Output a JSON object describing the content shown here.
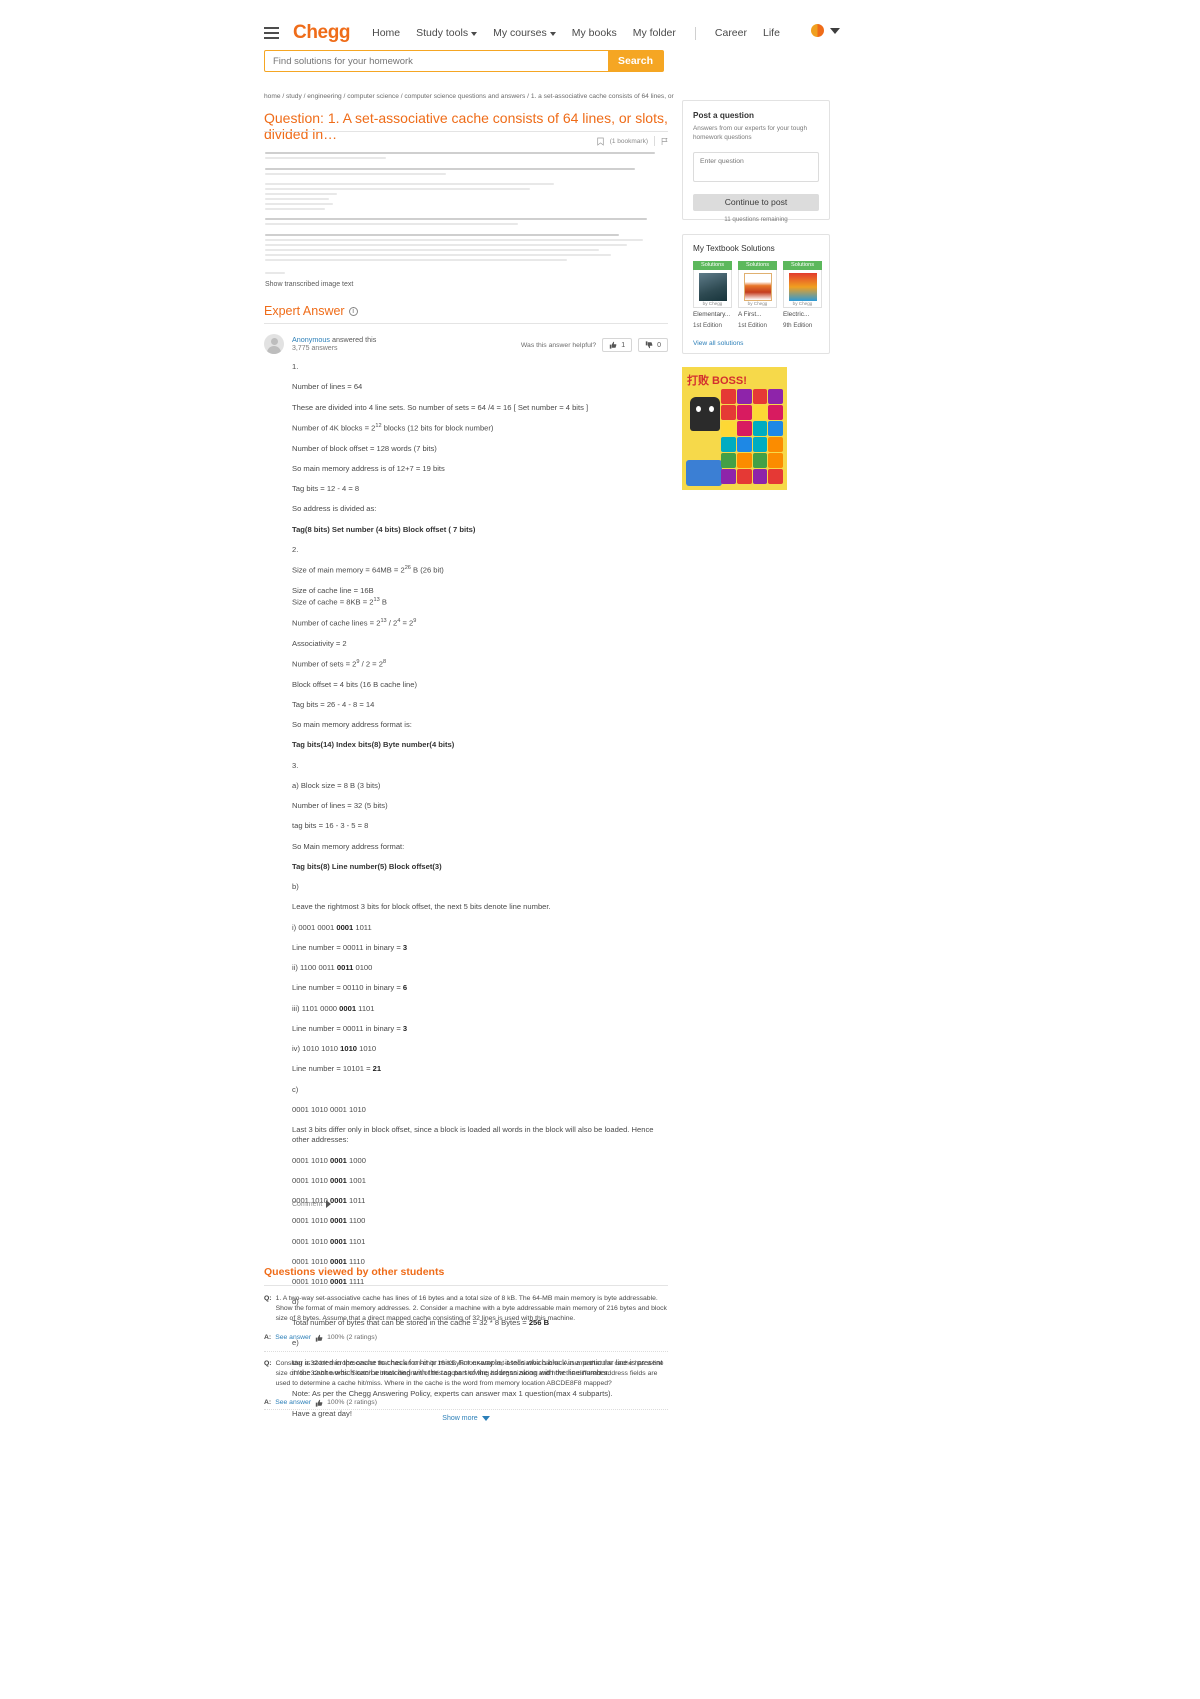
{
  "header": {
    "brand": "Chegg",
    "menu_icon": "hamburger-icon",
    "nav": [
      {
        "label": "Home",
        "caret": false
      },
      {
        "label": "Study tools",
        "caret": true
      },
      {
        "label": "My courses",
        "caret": true
      },
      {
        "label": "My books",
        "caret": false
      },
      {
        "label": "My folder",
        "caret": false
      },
      {
        "label": "Career",
        "caret": false
      },
      {
        "label": "Life",
        "caret": false
      }
    ]
  },
  "search": {
    "placeholder": "Find solutions for your homework",
    "value": "",
    "button_label": "Search"
  },
  "breadcrumb": "home / study / engineering / computer science / computer science questions and answers / 1. a set-associative cache consists of 64 lines, or slots, divi...",
  "question": {
    "title": "Question: 1. A set-associative cache consists of 64 lines, or slots, divided in…",
    "bookmarks": "(1 bookmark)",
    "show_transcribed": "Show transcribed image text"
  },
  "expert_answer": {
    "heading": "Expert Answer",
    "info_glyph": "i",
    "author": "Anonymous",
    "author_suffix": " answered this",
    "answers_count": "3,775 answers",
    "helpful_label": "Was this answer helpful?",
    "upvotes": "1",
    "downvotes": "0",
    "comment_label": "Comment",
    "body": [
      {
        "t": "1.",
        "style": "normal"
      },
      {
        "t": "Number of lines = 64",
        "style": "normal"
      },
      {
        "t": "These are divided into 4 line sets. So number of sets = 64 /4 = 16 [ Set number = 4 bits ]",
        "style": "normal"
      },
      {
        "t": "Number of 4K blocks = 2^12 blocks (12 bits for block number)",
        "style": "normal"
      },
      {
        "t": "Number of block offset = 128 words (7 bits)",
        "style": "normal"
      },
      {
        "t": "So main memory address is of 12+7 = 19 bits",
        "style": "normal"
      },
      {
        "t": "Tag bits = 12 - 4 = 8",
        "style": "normal"
      },
      {
        "t": "So address is divided as:",
        "style": "normal"
      },
      {
        "t": "Tag(8 bits) Set number (4 bits) Block offset ( 7 bits)",
        "style": "bold"
      },
      {
        "t": "2.",
        "style": "normal"
      },
      {
        "t": "Size of main memory = 64MB = 2^26 B (26 bit)",
        "style": "normal"
      },
      {
        "t": "Size of cache line = 16B",
        "style": "tight"
      },
      {
        "t": "Size of cache = 8KB = 2^13 B",
        "style": "normal"
      },
      {
        "t": "Number of cache lines = 2^13 / 2^4 = 2^9",
        "style": "normal"
      },
      {
        "t": "Associativity = 2",
        "style": "normal"
      },
      {
        "t": "Number of sets = 2^9 / 2 = 2^8",
        "style": "normal"
      },
      {
        "t": "Block offset = 4 bits (16 B cache line)",
        "style": "normal"
      },
      {
        "t": "Tag bits = 26 - 4 - 8 = 14",
        "style": "normal"
      },
      {
        "t": "So main memory address format is:",
        "style": "normal"
      },
      {
        "t": "Tag bits(14) Index bits(8) Byte number(4 bits)",
        "style": "bold"
      },
      {
        "t": "3.",
        "style": "normal"
      },
      {
        "t": "a) Block size = 8 B (3 bits)",
        "style": "normal"
      },
      {
        "t": "Number of lines = 32 (5 bits)",
        "style": "normal"
      },
      {
        "t": "tag bits = 16 - 3 - 5 = 8",
        "style": "normal"
      },
      {
        "t": "So Main memory address format:",
        "style": "normal"
      },
      {
        "t": "Tag bits(8) Line number(5) Block offset(3)",
        "style": "bold"
      },
      {
        "t": "b)",
        "style": "normal"
      },
      {
        "t": "Leave the rightmost 3 bits for block offset, the next 5 bits denote line number.",
        "style": "normal"
      },
      {
        "t": "i) 0001 0001 0001 1011",
        "style": "mixed-1"
      },
      {
        "t": "Line number = 00011 in binary = 3",
        "style": "mixed-2"
      },
      {
        "t": "ii) 1100 0011 0011 0100",
        "style": "mixed-1"
      },
      {
        "t": "Line number = 00110 in binary = 6",
        "style": "mixed-2"
      },
      {
        "t": "iii) 1101 0000 0001 1101",
        "style": "mixed-1"
      },
      {
        "t": "Line number = 00011 in binary = 3",
        "style": "mixed-2"
      },
      {
        "t": "iv) 1010 1010 1010 1010",
        "style": "mixed-1"
      },
      {
        "t": "Line number = 10101 = 21",
        "style": "mixed-2"
      },
      {
        "t": "c)",
        "style": "normal"
      },
      {
        "t": "0001 1010 0001 1010",
        "style": "normal"
      },
      {
        "t": "Last 3 bits differ only in block offset, since a block is loaded all words in the block will also be loaded. Hence other addresses:",
        "style": "normal"
      },
      {
        "t": "0001 1010 0001 1000",
        "style": "mixed-1"
      },
      {
        "t": "0001 1010 0001 1001",
        "style": "mixed-1"
      },
      {
        "t": "0001 1010 0001 1011",
        "style": "mixed-1"
      },
      {
        "t": "0001 1010 0001 1100",
        "style": "mixed-1"
      },
      {
        "t": "0001 1010 0001 1101",
        "style": "mixed-1"
      },
      {
        "t": "0001 1010 0001 1110",
        "style": "mixed-1"
      },
      {
        "t": "0001 1010 0001 1111",
        "style": "mixed-1"
      },
      {
        "t": "d)",
        "style": "normal"
      },
      {
        "t": "Total number of bytes that can be stored in the cache = 32 * 8 Bytes = 256 B",
        "style": "mixed-2"
      },
      {
        "t": "e)",
        "style": "normal"
      },
      {
        "t": "tag is stored in the cache to check for hit or miss. For example, it tells which block in a particular line is present in the cache which can be matched with the tag part of the address along with the line number.",
        "style": "normal"
      },
      {
        "t": "Note: As per the Chegg Answering Policy, experts can answer max 1 question(max 4 subparts).",
        "style": "normal"
      },
      {
        "t": "Have a great day!",
        "style": "normal"
      }
    ]
  },
  "post_card": {
    "title": "Post a question",
    "subtitle": "Answers from our experts for your tough homework questions",
    "input_placeholder": "Enter question",
    "input_value": "",
    "button_label": "Continue to post",
    "remaining": "11 questions remaining"
  },
  "books_card": {
    "title": "My Textbook Solutions",
    "view_all": "View all solutions",
    "books": [
      {
        "badge": "Solutions",
        "by": "by Chegg",
        "name": "Elementary...",
        "edition": "1st Edition"
      },
      {
        "badge": "Solutions",
        "by": "by Chegg",
        "name": "A First...",
        "edition": "1st Edition"
      },
      {
        "badge": "Solutions",
        "by": "by Chegg",
        "name": "Electric...",
        "edition": "9th Edition"
      }
    ]
  },
  "ad": {
    "title": "打败 BOSS!"
  },
  "questions_viewed": {
    "title": "Questions viewed by other students",
    "q_label": "Q:",
    "a_label": "A:",
    "see_answer": "See answer",
    "show_more": "Show more",
    "items": [
      {
        "question": "1. A two-way set-associative cache has lines of 16 bytes and a total size of 8 kB. The 64-MB main memory is byte addressable. Show the format of main memory addresses. 2. Consider a machine with a byte addressable main memory of 216 bytes and block size of 8 bytes. Assume that a direct mapped cache consisting of 32 lines is used with this machine.",
        "rating": "100% (2 ratings)"
      },
      {
        "question": "Consider a 32-bit microprocessor that has an on-chip 16-KByte four-way set-associative cache. Assume that the cache has a line size of four 32-bit words. Sketch a block diagram of this cache showing its organization and how the different address fields are used to determine a cache hit/miss. Where in the cache is the word from memory location ABCDE8F8 mapped?",
        "rating": "100% (2 ratings)"
      }
    ]
  },
  "colors": {
    "brand_orange": "#ef6c19",
    "search_orange": "#f5a623",
    "link_blue": "#2c7fb8",
    "badge_green": "#5cb85c"
  }
}
